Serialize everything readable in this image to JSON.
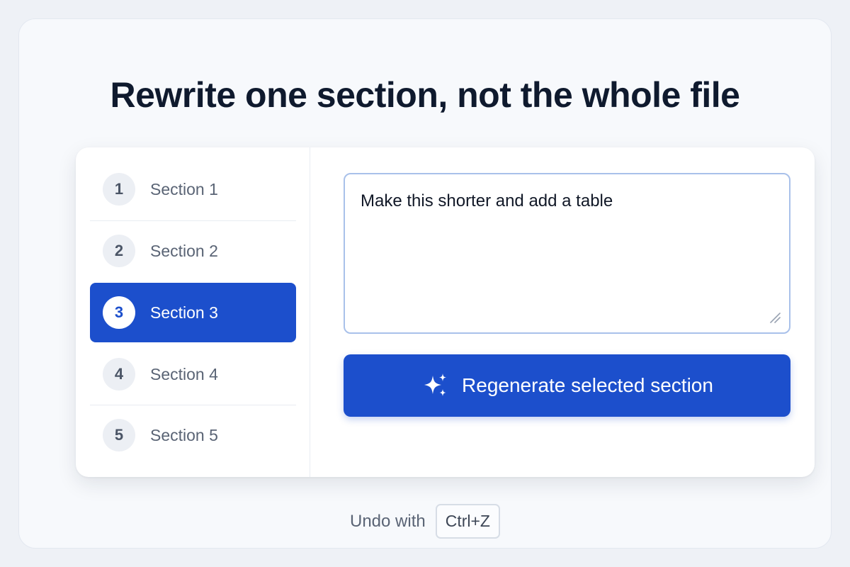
{
  "title": "Rewrite one section, not the whole file",
  "sections": [
    {
      "number": "1",
      "label": "Section 1",
      "selected": false
    },
    {
      "number": "2",
      "label": "Section 2",
      "selected": false
    },
    {
      "number": "3",
      "label": "Section 3",
      "selected": true
    },
    {
      "number": "4",
      "label": "Section 4",
      "selected": false
    },
    {
      "number": "5",
      "label": "Section 5",
      "selected": false
    }
  ],
  "prompt": {
    "value": "Make this shorter and add a table"
  },
  "regenerate": {
    "label": "Regenerate selected section",
    "icon": "sparkles-icon"
  },
  "undo": {
    "text": "Undo with",
    "shortcut": "Ctrl+Z"
  },
  "colors": {
    "accent": "#1c4fcc",
    "background": "#f7f9fc",
    "text": "#0f1a2e"
  }
}
